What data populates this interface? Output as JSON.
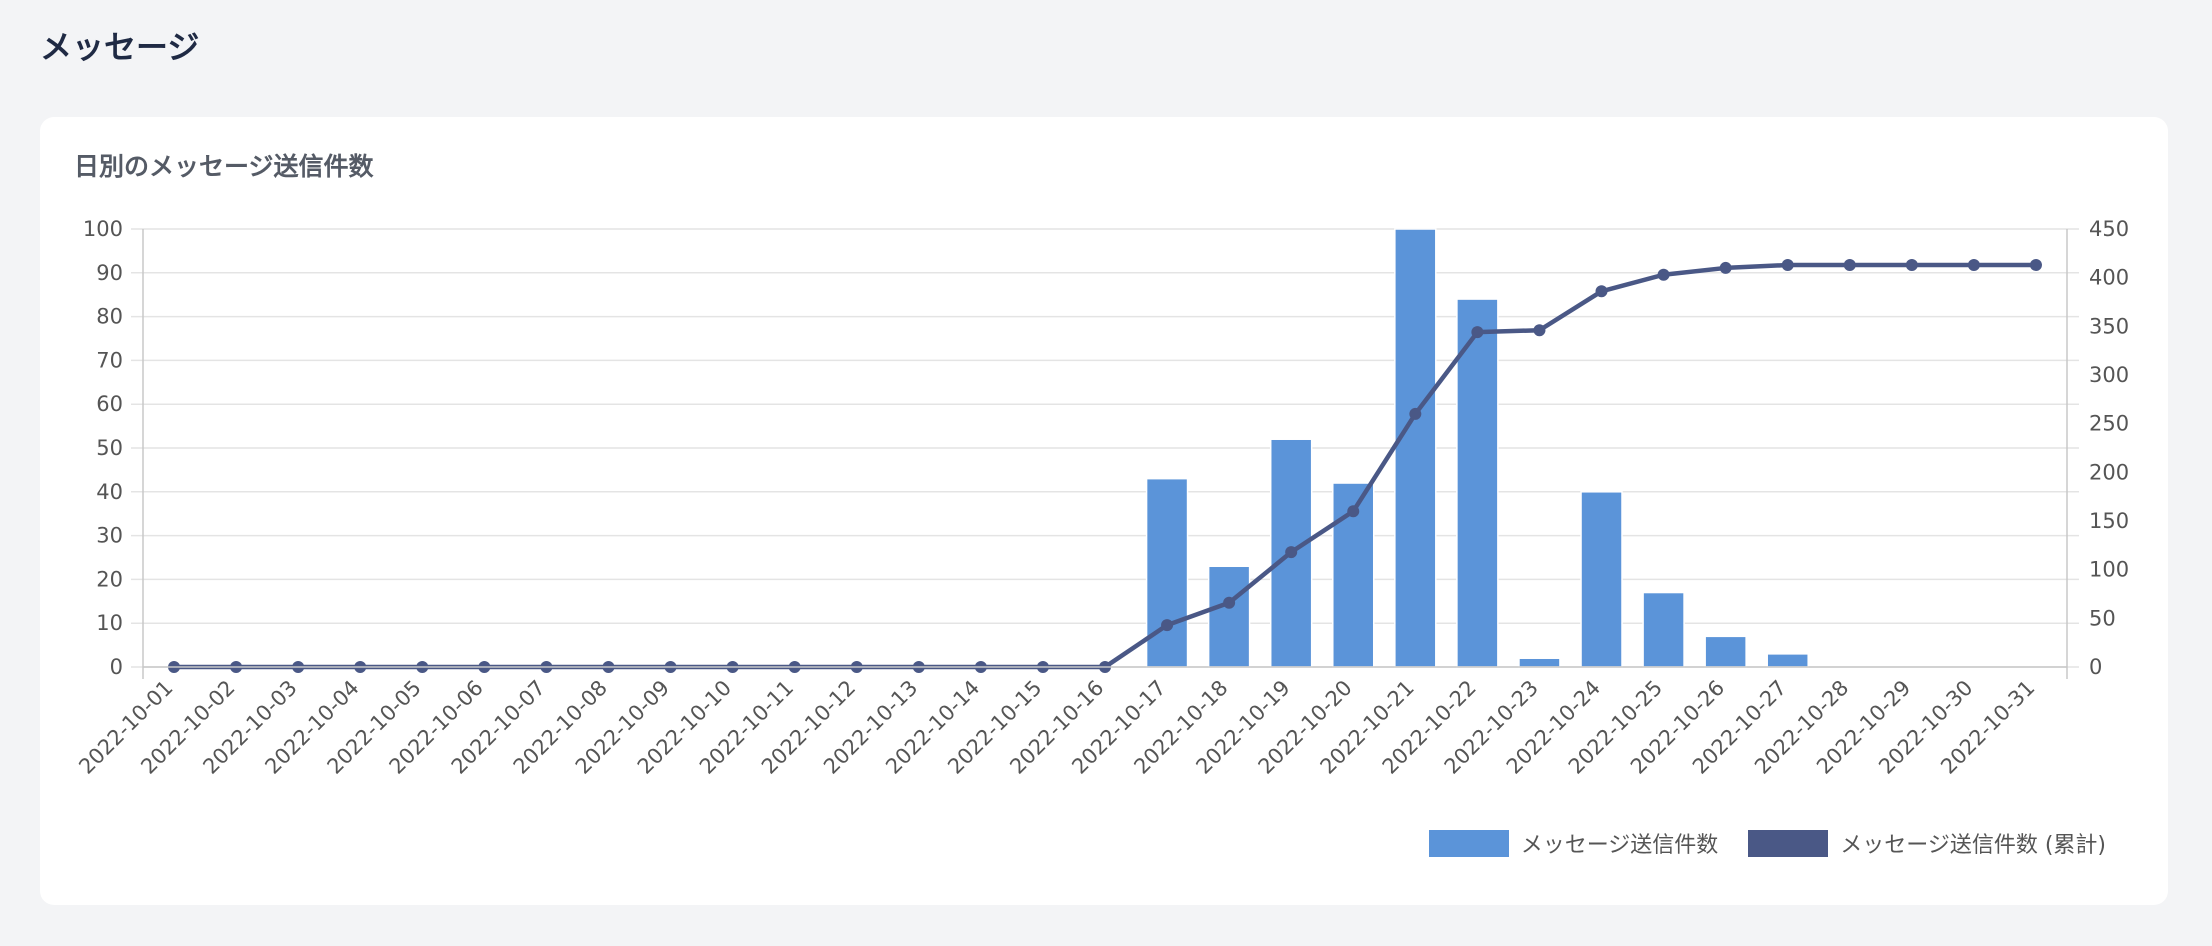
{
  "page": {
    "title": "メッセージ"
  },
  "card": {
    "title": "日別のメッセージ送信件数"
  },
  "colors": {
    "bar": "#5b94d9",
    "line": "#4a5886",
    "grid": "#e4e4e4",
    "axis": "#c8c8c8"
  },
  "chart_data": {
    "type": "bar",
    "title": "日別のメッセージ送信件数",
    "categories": [
      "2022-10-01",
      "2022-10-02",
      "2022-10-03",
      "2022-10-04",
      "2022-10-05",
      "2022-10-06",
      "2022-10-07",
      "2022-10-08",
      "2022-10-09",
      "2022-10-10",
      "2022-10-11",
      "2022-10-12",
      "2022-10-13",
      "2022-10-14",
      "2022-10-15",
      "2022-10-16",
      "2022-10-17",
      "2022-10-18",
      "2022-10-19",
      "2022-10-20",
      "2022-10-21",
      "2022-10-22",
      "2022-10-23",
      "2022-10-24",
      "2022-10-25",
      "2022-10-26",
      "2022-10-27",
      "2022-10-28",
      "2022-10-29",
      "2022-10-30",
      "2022-10-31"
    ],
    "series": [
      {
        "name": "メッセージ送信件数",
        "type": "bar",
        "axis": "left",
        "values": [
          0,
          0,
          0,
          0,
          0,
          0,
          0,
          0,
          0,
          0,
          0,
          0,
          0,
          0,
          0,
          0,
          43,
          23,
          52,
          42,
          100,
          84,
          2,
          40,
          17,
          7,
          3,
          0,
          0,
          0,
          0
        ]
      },
      {
        "name": "メッセージ送信件数 (累計)",
        "type": "line",
        "axis": "right",
        "values": [
          0,
          0,
          0,
          0,
          0,
          0,
          0,
          0,
          0,
          0,
          0,
          0,
          0,
          0,
          0,
          0,
          43,
          66,
          118,
          160,
          260,
          344,
          346,
          386,
          403,
          410,
          413,
          413,
          413,
          413,
          413
        ]
      }
    ],
    "y_left": {
      "min": 0,
      "max": 100,
      "ticks": [
        0,
        10,
        20,
        30,
        40,
        50,
        60,
        70,
        80,
        90,
        100
      ]
    },
    "y_right": {
      "min": 0,
      "max": 450,
      "ticks": [
        0,
        50,
        100,
        150,
        200,
        250,
        300,
        350,
        400,
        450
      ]
    },
    "grid": true,
    "legend_position": "bottom-right"
  }
}
